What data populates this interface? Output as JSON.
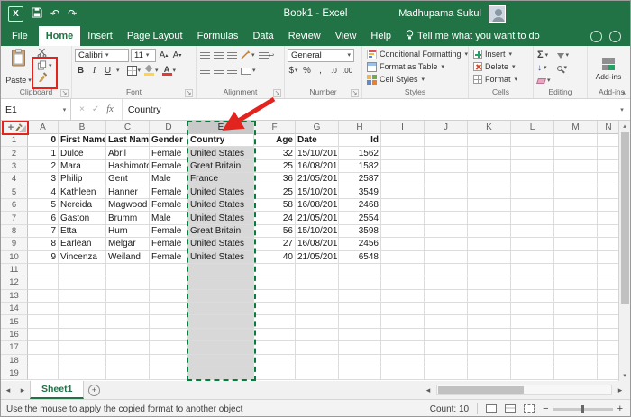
{
  "colors": {
    "excel_green": "#217346",
    "annotation_red": "#e3231d",
    "selection_fill": "#d8d8d8"
  },
  "icons": {
    "undo": "↶",
    "redo": "↷",
    "dropdown": "▾",
    "dropdown_up": "▴",
    "nav_left": "◂",
    "nav_right": "▸",
    "scroll_up": "▴",
    "scroll_down": "▾",
    "cancel": "×",
    "enter": "✓",
    "autosum": "Σ",
    "collapse_ribbon": "∧",
    "launcher": "↘",
    "cursor_plus": "+",
    "zoom_out": "−",
    "zoom_in": "+",
    "add_sheet": "+",
    "fill_down": "↓",
    "wrap_return": "↩",
    "grow": "A",
    "shrink": "A"
  },
  "titlebar": {
    "title": "Book1 - Excel",
    "user": "Madhupama Sukul"
  },
  "tabbar": {
    "tabs": [
      {
        "label": "File",
        "file": true
      },
      {
        "label": "Home",
        "active": true
      },
      {
        "label": "Insert"
      },
      {
        "label": "Page Layout"
      },
      {
        "label": "Formulas"
      },
      {
        "label": "Data"
      },
      {
        "label": "Review"
      },
      {
        "label": "View"
      },
      {
        "label": "Help"
      },
      {
        "label": "Tell me what you want to do",
        "tellme": true
      }
    ]
  },
  "ribbon": {
    "clipboard": {
      "label": "Clipboard",
      "paste": "Paste"
    },
    "font": {
      "label": "Font",
      "name": "Calibri",
      "size": "11",
      "bold": "B",
      "italic": "I",
      "underline": "U",
      "color_letter": "A"
    },
    "alignment": {
      "label": "Alignment"
    },
    "number": {
      "label": "Number",
      "format": "General",
      "currency": "$",
      "percent": "%",
      "comma": ",",
      "inc_decimal": ".0",
      "dec_decimal": ".00"
    },
    "styles": {
      "label": "Styles",
      "items": [
        "Conditional Formatting",
        "Format as Table",
        "Cell Styles"
      ]
    },
    "cells": {
      "label": "Cells",
      "items": [
        "Insert",
        "Delete",
        "Format"
      ]
    },
    "editing": {
      "label": "Editing"
    },
    "addins": {
      "label": "Add-ins",
      "button": "Add-ins"
    }
  },
  "formula_bar": {
    "name_box": "E1",
    "fx": "fx",
    "value": "Country"
  },
  "sheet": {
    "columns": [
      "A",
      "B",
      "C",
      "D",
      "E",
      "F",
      "G",
      "H",
      "I",
      "J",
      "K",
      "L",
      "M",
      "N"
    ],
    "selected_column": "E",
    "active_cell": "E1",
    "visible_row_count": 19,
    "rows": [
      [
        "0",
        "First Name",
        "Last Name",
        "Gender",
        "Country",
        "Age",
        "Date",
        "Id"
      ],
      [
        "1",
        "Dulce",
        "Abril",
        "Female",
        "United States",
        "32",
        "15/10/201",
        "1562"
      ],
      [
        "2",
        "Mara",
        "Hashimoto",
        "Female",
        "Great Britain",
        "25",
        "16/08/201",
        "1582"
      ],
      [
        "3",
        "Philip",
        "Gent",
        "Male",
        "France",
        "36",
        "21/05/201",
        "2587"
      ],
      [
        "4",
        "Kathleen",
        "Hanner",
        "Female",
        "United States",
        "25",
        "15/10/201",
        "3549"
      ],
      [
        "5",
        "Nereida",
        "Magwood",
        "Female",
        "United States",
        "58",
        "16/08/201",
        "2468"
      ],
      [
        "6",
        "Gaston",
        "Brumm",
        "Male",
        "United States",
        "24",
        "21/05/201",
        "2554"
      ],
      [
        "7",
        "Etta",
        "Hurn",
        "Female",
        "Great Britain",
        "56",
        "15/10/201",
        "3598"
      ],
      [
        "8",
        "Earlean",
        "Melgar",
        "Female",
        "United States",
        "27",
        "16/08/201",
        "2456"
      ],
      [
        "9",
        "Vincenza",
        "Weiland",
        "Female",
        "United States",
        "40",
        "21/05/201",
        "6548"
      ]
    ]
  },
  "sheet_bar": {
    "active_sheet": "Sheet1"
  },
  "status_bar": {
    "hint": "Use the mouse to apply the copied format to another object",
    "count": "Count: 10"
  }
}
